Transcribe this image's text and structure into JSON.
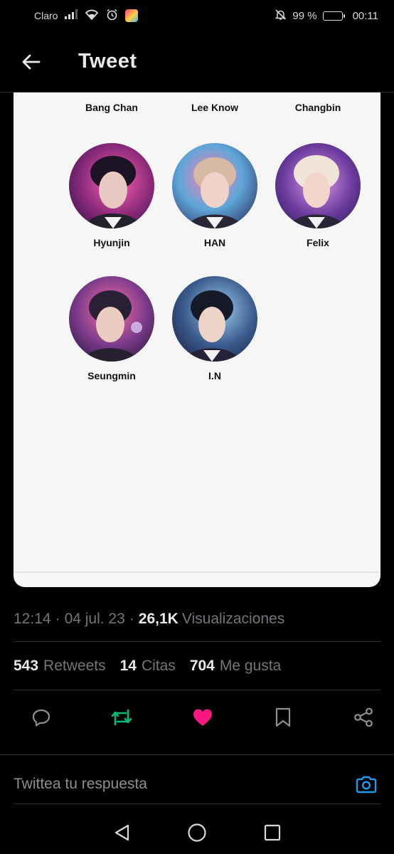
{
  "status_bar": {
    "carrier": "Claro",
    "battery": "99 %",
    "battery_level": 0.99,
    "time": "00:11"
  },
  "header": {
    "title": "Tweet"
  },
  "members": [
    {
      "name": "Bang Chan"
    },
    {
      "name": "Lee Know"
    },
    {
      "name": "Changbin"
    },
    {
      "name": "Hyunjin"
    },
    {
      "name": "HAN"
    },
    {
      "name": "Felix"
    },
    {
      "name": "Seungmin"
    },
    {
      "name": "I.N"
    }
  ],
  "meta": {
    "time": "12:14",
    "date": "04 jul. 23",
    "separator": "·",
    "views": "26,1K",
    "views_label": "Visualizaciones"
  },
  "stats": {
    "retweets": "543",
    "retweets_label": "Retweets",
    "quotes": "14",
    "quotes_label": "Citas",
    "likes": "704",
    "likes_label": "Me gusta"
  },
  "reply": {
    "placeholder": "Twittea tu respuesta"
  },
  "colors": {
    "retweet": "#00ba7c",
    "like": "#f91880",
    "camera": "#1d9bf0"
  }
}
